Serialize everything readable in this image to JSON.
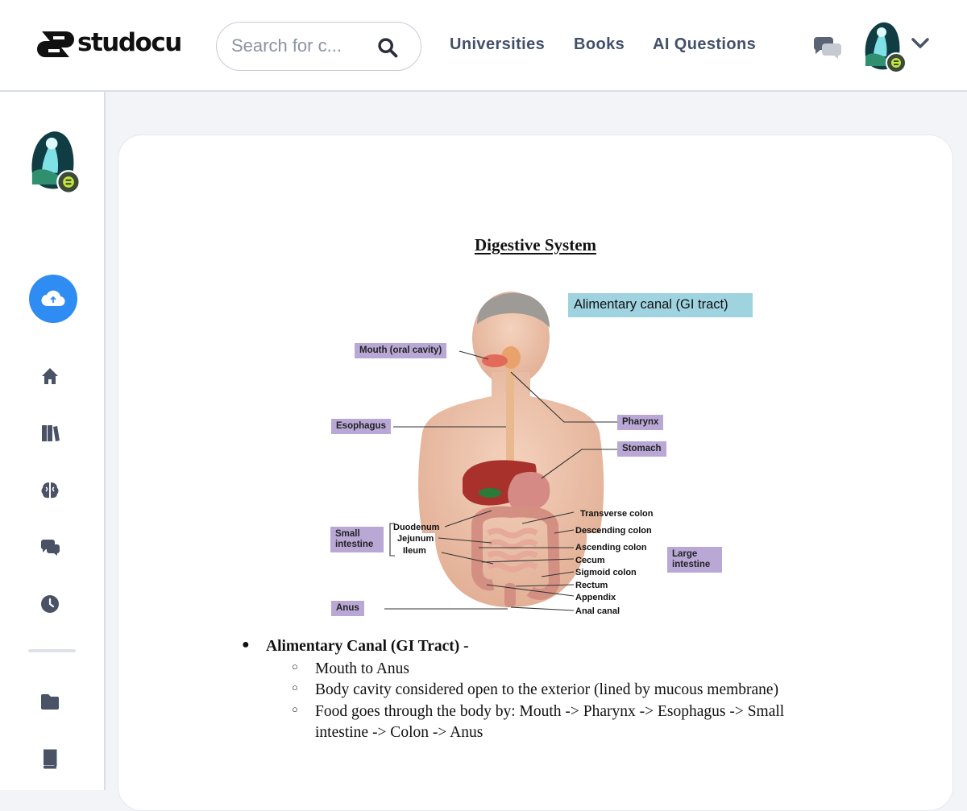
{
  "brand": {
    "name": "studocu"
  },
  "search": {
    "placeholder": "Search for c..."
  },
  "nav": {
    "items": [
      "Universities",
      "Books",
      "AI Questions"
    ]
  },
  "document": {
    "title": "Digestive System",
    "figure": {
      "tag": "Alimentary canal (GI tract)",
      "labels": {
        "mouth": "Mouth (oral cavity)",
        "esophagus": "Esophagus",
        "pharynx": "Pharynx",
        "stomach": "Stomach",
        "small_intestine": "Small intestine",
        "large_intestine": "Large intestine",
        "anus": "Anus"
      },
      "small_parts": [
        "Duodenum",
        "Jejunum",
        "Ileum"
      ],
      "large_parts": [
        "Transverse colon",
        "Descending colon",
        "Ascending colon",
        "Cecum",
        "Sigmoid colon",
        "Rectum",
        "Appendix",
        "Anal canal"
      ]
    },
    "bullet": {
      "heading": "Alimentary Canal (GI Tract) -",
      "points": [
        "Mouth to Anus",
        "Body cavity considered open to the exterior (lined by mucous membrane)",
        "Food goes through the body by: Mouth -> Pharynx -> Esophagus -> Small",
        "intestine -> Colon -> Anus"
      ]
    }
  },
  "colors": {
    "accent": "#2f8cf3",
    "label_bg": "#b9a8d6",
    "tag_bg": "#9fd3e0"
  }
}
